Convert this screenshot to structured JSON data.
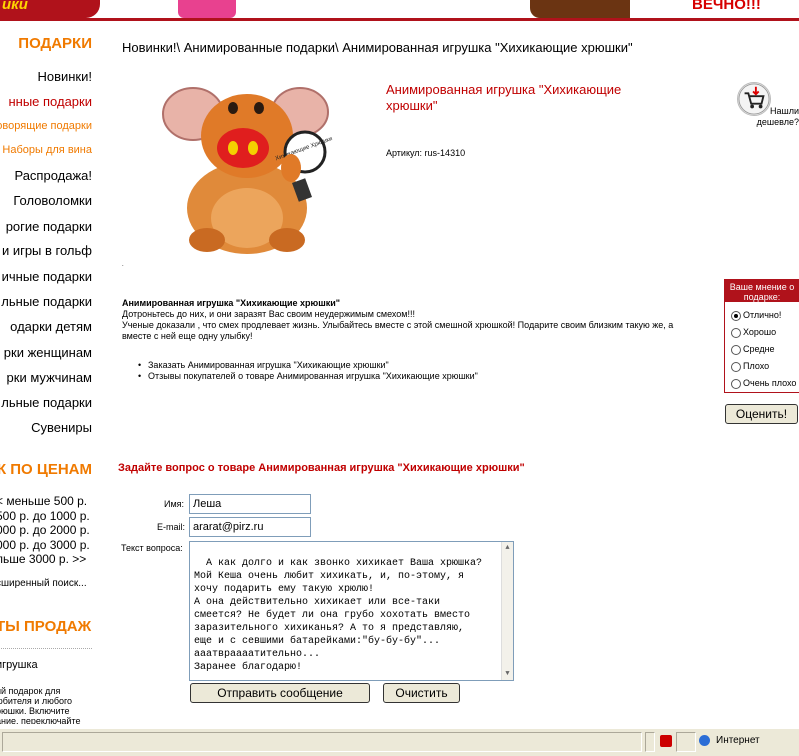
{
  "banner": {
    "left_text": "ики",
    "right_text": "ВЕЧНО!!!"
  },
  "sidebar": {
    "heading_gifts": "ПОДАРКИ",
    "items": [
      {
        "label": "Новинки!",
        "style": "normal"
      },
      {
        "label": "нные подарки",
        "style": "red"
      },
      {
        "label": "оворящие подарки",
        "style": "orange"
      },
      {
        "label": "Наборы для вина",
        "style": "orange"
      },
      {
        "label": "Распродажа!",
        "style": "normal"
      },
      {
        "label": "Головоломки",
        "style": "normal"
      },
      {
        "label": "рогие подарки",
        "style": "normal"
      },
      {
        "label": "и игры в гольф",
        "style": "normal"
      },
      {
        "label": "ичные подарки",
        "style": "normal"
      },
      {
        "label": "льные подарки",
        "style": "normal"
      },
      {
        "label": "одарки детям",
        "style": "normal"
      },
      {
        "label": "рки женщинам",
        "style": "normal"
      },
      {
        "label": "рки мужчинам",
        "style": "normal"
      },
      {
        "label": "льные подарки",
        "style": "normal"
      },
      {
        "label": "Сувениры",
        "style": "normal"
      }
    ],
    "heading_prices": "К ПО ЦЕНАМ",
    "prices": [
      "< меньше 500 р.",
      "500 р. до 1000 р.",
      "000 р. до 2000 р.",
      "000 р. до 3000 р.",
      "льше 3000 р. >>"
    ],
    "advanced_search": "сширенный поиск...",
    "heading_sales": "ТЫ ПРОДАЖ",
    "sales_item": "игрушка",
    "promo_lines": [
      "ий подарок для",
      "юбителя и любого",
      "рюшки. Включите",
      "ание, переключайте"
    ]
  },
  "breadcrumb": "Новинки!\\ Анимированные подарки\\ Анимированная игрушка \"Хихикающие хрюшки\"",
  "product": {
    "title": "Анимированная игрушка \"Хихикающие хрюшки\"",
    "article": "Артикул: rus-14310",
    "tag_text": "Хихикающие Хрюшки",
    "cheaper_label": "Нашли дешевле?",
    "dot": ".",
    "desc_title": "Анимированная игрушка \"Хихикающие хрюшки\"",
    "desc_lines": [
      "Дотроньтесь до них, и они заразят Вас своим неудержимым смехом!!!",
      "Ученые доказали , что смех продлевает жизнь. Улыбайтесь вместе с этой смешной хрюшкой! Подарите своим близким такую же, а вместе с ней еще одну улыбку!"
    ],
    "links": [
      "Заказать Анимированная игрушка \"Хихикающие хрюшки\"",
      "Отзывы покупателей о товаре Анимированная игрушка \"Хихикающие хрюшки\""
    ]
  },
  "poll": {
    "title": "Ваше мнение о подарке:",
    "options": [
      {
        "label": "Отлично!",
        "selected": true
      },
      {
        "label": "Хорошо",
        "selected": false
      },
      {
        "label": "Средне",
        "selected": false
      },
      {
        "label": "Плохо",
        "selected": false
      },
      {
        "label": "Очень плохо",
        "selected": false
      }
    ],
    "submit": "Оценить!"
  },
  "question_form": {
    "title": "Задайте вопрос о товаре Анимированная игрушка \"Хихикающие хрюшки\"",
    "name_label": "Имя:",
    "name_value": "Леша",
    "email_label": "E-mail:",
    "email_value": "ararat@pirz.ru",
    "question_label": "Текст вопроса:",
    "question_value": "А как долго и как звонко хихикает Ваша хрюшка?\nМой Кеша очень любит хихикать, и, по-этому, я\nхочу подарить ему такую хрюлю!\nА она действительно хихикает или все-таки\nсмеется? Не будет ли она грубо хохотать вместо\nзаразительного хихиканья? А то я представляю,\nеще и с севшими батарейками:\"бу-бу-бу\"...\nааатвраааатительно...\nЗаранее благодарю!",
    "send_button": "Отправить сообщение",
    "clear_button": "Очистить"
  },
  "statusbar": {
    "zone": "Интернет"
  },
  "colors": {
    "brand_red": "#b0121b",
    "title_red": "#c00000",
    "orange": "#f07a00"
  }
}
